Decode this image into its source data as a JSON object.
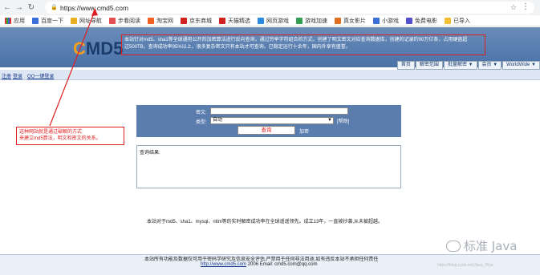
{
  "browser": {
    "url": "https://www.cmd5.com",
    "bookmarks": [
      "应用",
      "百度一下",
      "网址导航",
      "步看阅读",
      "淘宝网",
      "京东商城",
      "天猫精选",
      "网页游戏",
      "游戏加速",
      "真女影片",
      "小游戏",
      "免费电影",
      "已导入"
    ],
    "colors": {
      "red_accent": "#e02020",
      "link_blue": "#1c3c8c",
      "header_blue": "#5a7dae"
    }
  },
  "site": {
    "logo_c": "C",
    "logo_rest": "MD5",
    "notice_line1": "本站针对md5、sha1等全球通用公开的加密算法进行反向查询，通过穷举字符组合的方式，创建了明文密文对应查询数据库，创建的记录约90万亿条，占用硬盘超",
    "notice_line2": "过500TB，查询成功率95%以上，很多复杂密文只有本站才可查询。已稳定运行十余年，国内外享有盛誉。",
    "nav": [
      "首页",
      "解密范围",
      "批量解密 ▼",
      "会员 ▼",
      "WorldWide ▼"
    ],
    "login_links": [
      "注册",
      "登录",
      "QQ一键登录"
    ]
  },
  "query": {
    "cipher_label": "密文:",
    "type_label": "类型:",
    "type_value": "自动",
    "help_label": "[帮助]",
    "submit_label": "查询",
    "encrypt_label": "加密",
    "result_label": "查询结果:"
  },
  "description": "本站对于md5、sha1、mysql、ntlm等的实时解密成功率在全球遥遥领先。成立13年，一直被抄袭,从未被超越。",
  "footer": {
    "line1": "本站所有功能及数据仅可用于密码学研究及信息安全评估,严禁用于任何非法用途,如有违反本站不承担任何责任",
    "site_link": "http://www.cmd5.com",
    "year": "2006",
    "email": "Email: cmd5.com@qq.com"
  },
  "annotation": {
    "line1": "这种网站就是通过破解的方式",
    "line2": "来建立md5算法，明文和密文的关系。"
  },
  "watermark": {
    "brand": "标准 Java",
    "csdn": "https://blog.csdn.net/Java_Hiya"
  }
}
